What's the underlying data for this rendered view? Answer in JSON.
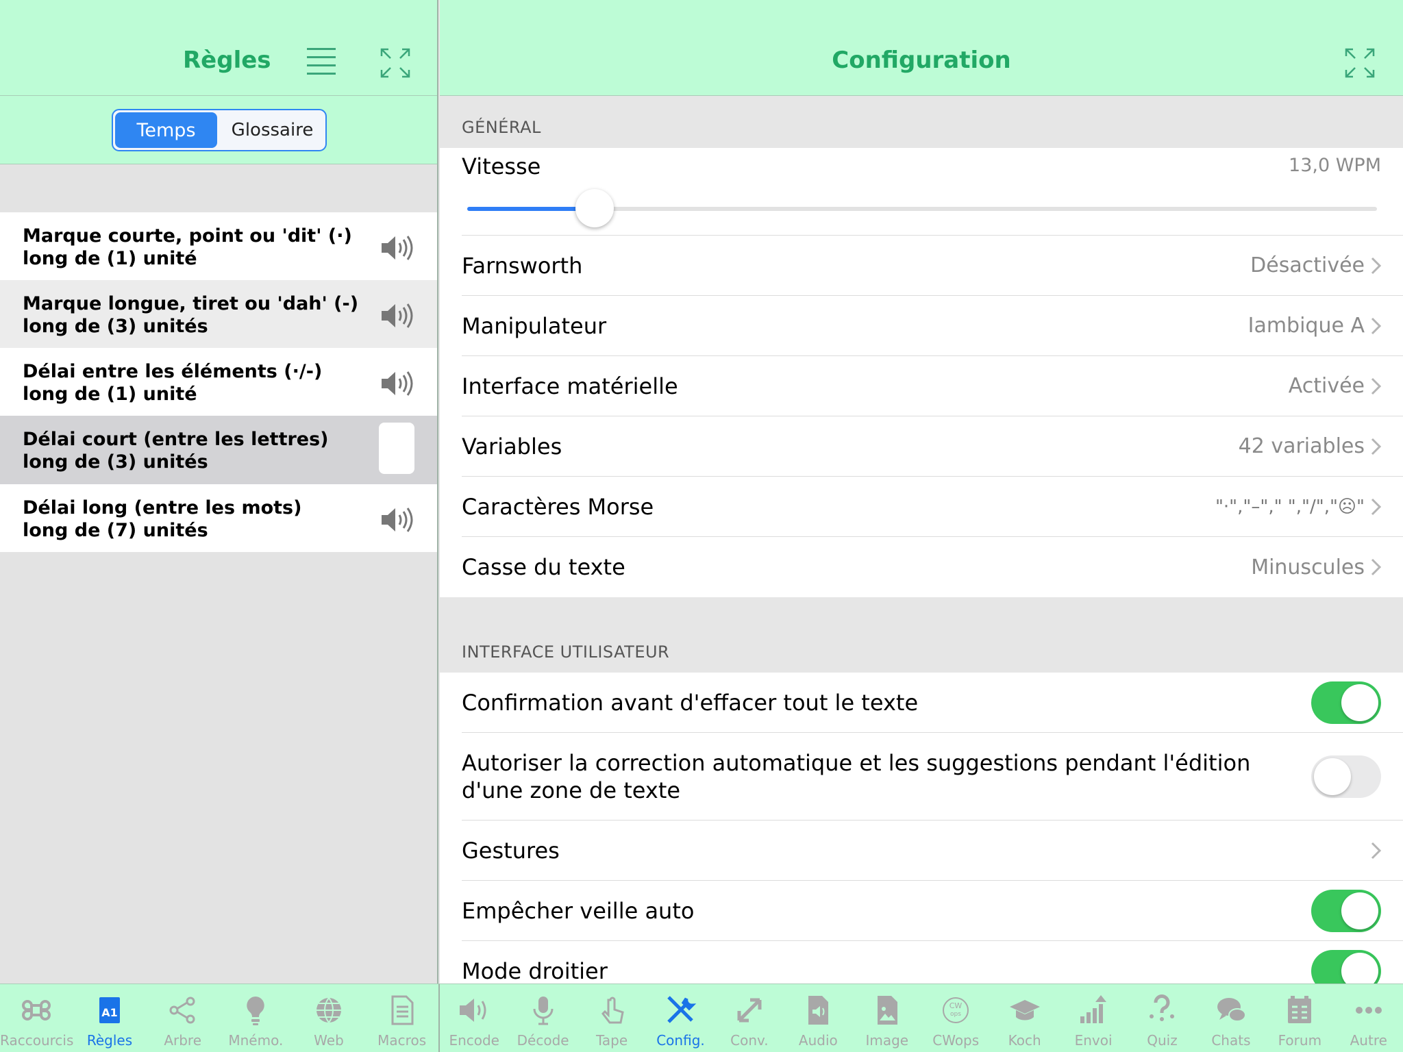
{
  "left": {
    "title": "Règles",
    "segment": {
      "temps": "Temps",
      "glossaire": "Glossaire"
    },
    "rules": [
      {
        "line1": "Marque courte, point ou 'dit' (·)",
        "line2": "long de (1) unité"
      },
      {
        "line1": "Marque longue, tiret ou 'dah' (-)",
        "line2": "long de (3) unités"
      },
      {
        "line1": "Délai entre les éléments (·/-)",
        "line2": "long de (1) unité"
      },
      {
        "line1": "Délai court (entre les lettres)",
        "line2": "long de (3) unités"
      },
      {
        "line1": "Délai long (entre les mots)",
        "line2": "long de (7) unités"
      }
    ]
  },
  "right": {
    "title": "Configuration",
    "general": {
      "header": "GÉNÉRAL",
      "speed_label": "Vitesse",
      "speed_value": "13,0 WPM",
      "speed_fraction": 0.14,
      "rows": [
        {
          "label": "Farnsworth",
          "value": "Désactivée"
        },
        {
          "label": "Manipulateur",
          "value": "Iambique A"
        },
        {
          "label": "Interface matérielle",
          "value": "Activée"
        },
        {
          "label": "Variables",
          "value": "42 variables"
        },
        {
          "label": "Caractères Morse",
          "value": "\"·\",\"–\",\" \",\"/\",\"☹\""
        },
        {
          "label": "Casse du texte",
          "value": "Minuscules"
        }
      ]
    },
    "ui": {
      "header": "INTERFACE UTILISATEUR",
      "confirm_label": "Confirmation avant d'effacer tout le texte",
      "confirm_on": true,
      "autocorrect_label": "Autoriser la correction automatique et les suggestions pendant l'édition d'une zone de texte",
      "autocorrect_on": false,
      "gestures_label": "Gestures",
      "sleep_label": "Empêcher veille auto",
      "sleep_on": true,
      "righthand_label": "Mode droitier",
      "righthand_on": true
    }
  },
  "tabs": [
    {
      "label": "Raccourcis",
      "icon": "command-icon"
    },
    {
      "label": "Règles",
      "icon": "rules-book-icon",
      "active": true
    },
    {
      "label": "Arbre",
      "icon": "tree-icon"
    },
    {
      "label": "Mnémo.",
      "icon": "lightbulb-icon"
    },
    {
      "label": "Web",
      "icon": "globe-icon"
    },
    {
      "label": "Macros",
      "icon": "document-icon"
    },
    {
      "label": "Encode",
      "icon": "speaker-icon"
    },
    {
      "label": "Décode",
      "icon": "microphone-icon"
    },
    {
      "label": "Tape",
      "icon": "hand-tap-icon"
    },
    {
      "label": "Config.",
      "icon": "tools-icon",
      "active": true
    },
    {
      "label": "Conv.",
      "icon": "convert-arrows-icon"
    },
    {
      "label": "Audio",
      "icon": "audio-file-icon"
    },
    {
      "label": "Image",
      "icon": "image-file-icon"
    },
    {
      "label": "CWops",
      "icon": "cwops-icon"
    },
    {
      "label": "Koch",
      "icon": "graduation-cap-icon"
    },
    {
      "label": "Envoi",
      "icon": "chart-up-icon"
    },
    {
      "label": "Quiz",
      "icon": "question-icon"
    },
    {
      "label": "Chats",
      "icon": "chat-bubbles-icon"
    },
    {
      "label": "Forum",
      "icon": "forum-board-icon"
    },
    {
      "label": "Autre",
      "icon": "more-dots-icon"
    }
  ],
  "colors": {
    "header_bg": "#bdfcd6",
    "title": "#21a865",
    "accent": "#2f86f2",
    "toggle_on": "#39c75c"
  }
}
